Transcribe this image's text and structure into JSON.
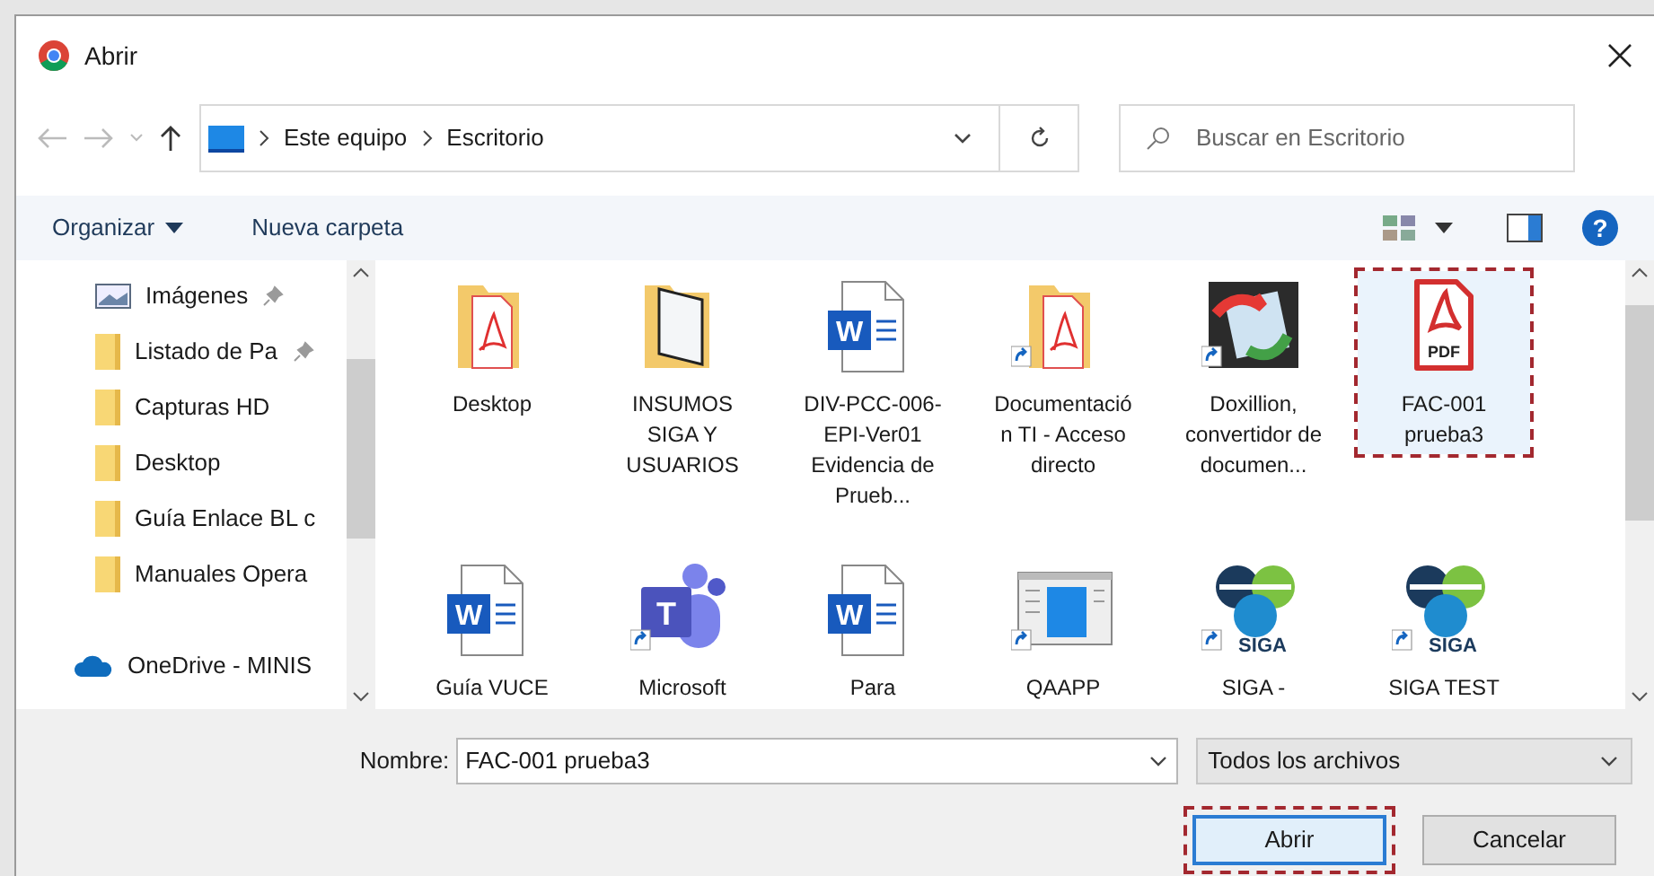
{
  "window": {
    "title": "Abrir"
  },
  "address": {
    "path": [
      "Este equipo",
      "Escritorio"
    ]
  },
  "search": {
    "placeholder": "Buscar en Escritorio"
  },
  "toolbar": {
    "organize": "Organizar",
    "new_folder": "Nueva carpeta",
    "help": "?"
  },
  "sidebar": {
    "items": [
      {
        "label": "Imágenes",
        "kind": "pictures",
        "pinned": true
      },
      {
        "label": "Listado de Pa",
        "kind": "folder",
        "pinned": true
      },
      {
        "label": "Capturas HD",
        "kind": "folder",
        "pinned": false
      },
      {
        "label": "Desktop",
        "kind": "folder",
        "pinned": false
      },
      {
        "label": "Guía Enlace BL c",
        "kind": "folder",
        "pinned": false
      },
      {
        "label": "Manuales Opera",
        "kind": "folder",
        "pinned": false
      },
      {
        "label": "OneDrive - MINIS",
        "kind": "cloud",
        "pinned": false
      }
    ]
  },
  "files": [
    {
      "label": "Desktop",
      "kind": "pdf-folder",
      "shortcut": false,
      "selected": false
    },
    {
      "label": "INSUMOS SIGA Y USUARIOS",
      "kind": "folder",
      "shortcut": false,
      "selected": false
    },
    {
      "label": "DIV-PCC-006-EPI-Ver01 Evidencia de Prueb...",
      "kind": "word",
      "icon_text": "W",
      "shortcut": false,
      "selected": false
    },
    {
      "label": "Documentación TI - Acceso directo",
      "kind": "pdf-folder",
      "shortcut": true,
      "selected": false
    },
    {
      "label": "Doxillion, convertidor de documen...",
      "kind": "app",
      "shortcut": true,
      "selected": false
    },
    {
      "label": "FAC-001 prueba3",
      "kind": "pdf",
      "icon_text": "PDF",
      "shortcut": false,
      "selected": true
    },
    {
      "label": "Guía VUCE",
      "kind": "word",
      "icon_text": "W",
      "shortcut": false,
      "selected": false
    },
    {
      "label": "Microsoft",
      "kind": "teams",
      "icon_text": "T",
      "shortcut": true,
      "selected": false
    },
    {
      "label": "Para",
      "kind": "word",
      "icon_text": "W",
      "shortcut": false,
      "selected": false
    },
    {
      "label": "QAAPP",
      "kind": "window",
      "shortcut": true,
      "selected": false
    },
    {
      "label": "SIGA -",
      "kind": "siga",
      "icon_text": "SIGA",
      "shortcut": true,
      "selected": false
    },
    {
      "label": "SIGA TEST",
      "kind": "siga",
      "icon_text": "SIGA",
      "shortcut": true,
      "selected": false
    }
  ],
  "filename": {
    "label": "Nombre:",
    "value": "FAC-001 prueba3"
  },
  "filter": {
    "value": "Todos los archivos"
  },
  "buttons": [
    {
      "label": "Abrir",
      "selected": true
    },
    {
      "label": "Cancelar",
      "selected": false
    }
  ]
}
